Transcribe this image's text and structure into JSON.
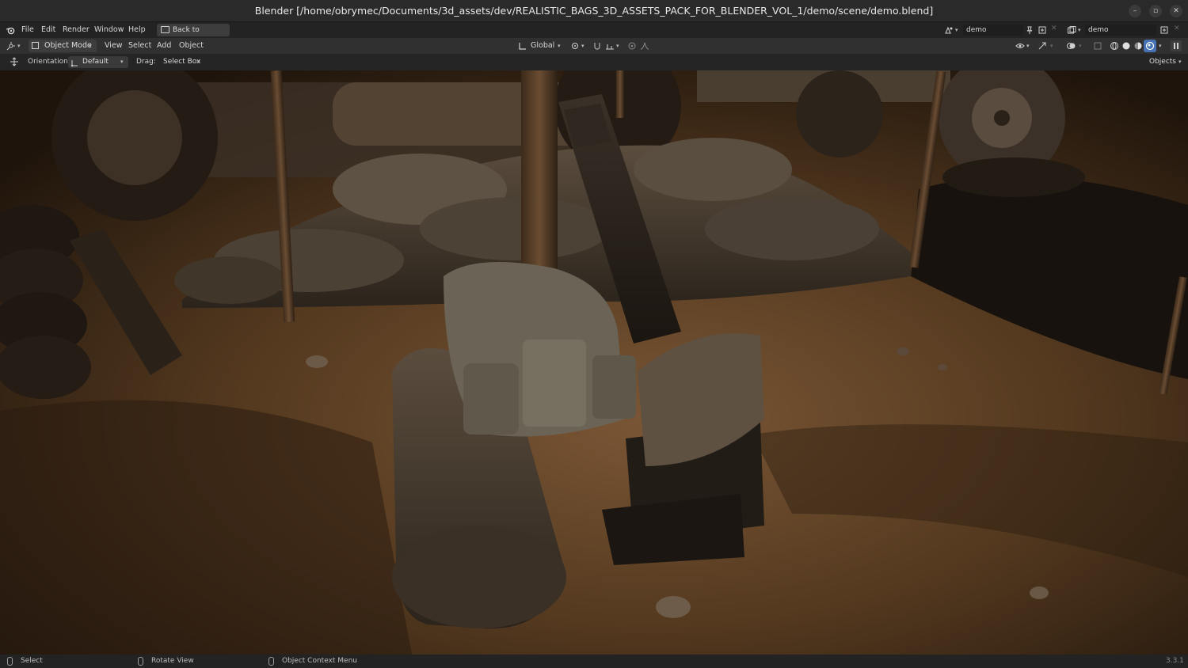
{
  "window": {
    "title": "Blender [/home/obrymec/Documents/3d_assets/dev/REALISTIC_BAGS_3D_ASSETS_PACK_FOR_BLENDER_VOL_1/demo/scene/demo.blend]"
  },
  "menubar": {
    "items": [
      "File",
      "Edit",
      "Render",
      "Window",
      "Help"
    ],
    "back_button": "Back to Previous",
    "scene_name": "demo",
    "view_layer": "demo"
  },
  "header": {
    "mode": "Object Mode",
    "menus": [
      "View",
      "Select",
      "Add",
      "Object"
    ],
    "transform_orientation": "Global"
  },
  "toolbar": {
    "orientation_label": "Orientation:",
    "orientation_value": "Default",
    "drag_label": "Drag:",
    "drag_value": "Select Box",
    "objects_label": "Objects"
  },
  "statusbar": {
    "select": "Select",
    "rotate": "Rotate View",
    "context": "Object Context Menu",
    "version": "3.3.1"
  },
  "icons": {
    "blender_logo": "blender-logo-icon",
    "shading": [
      "wireframe",
      "solid",
      "material-preview",
      "rendered"
    ]
  },
  "colors": {
    "ui_dark": "#232323",
    "ui_header": "#303030",
    "accent_active": "#4772b3",
    "sand": "#6e4e31"
  }
}
